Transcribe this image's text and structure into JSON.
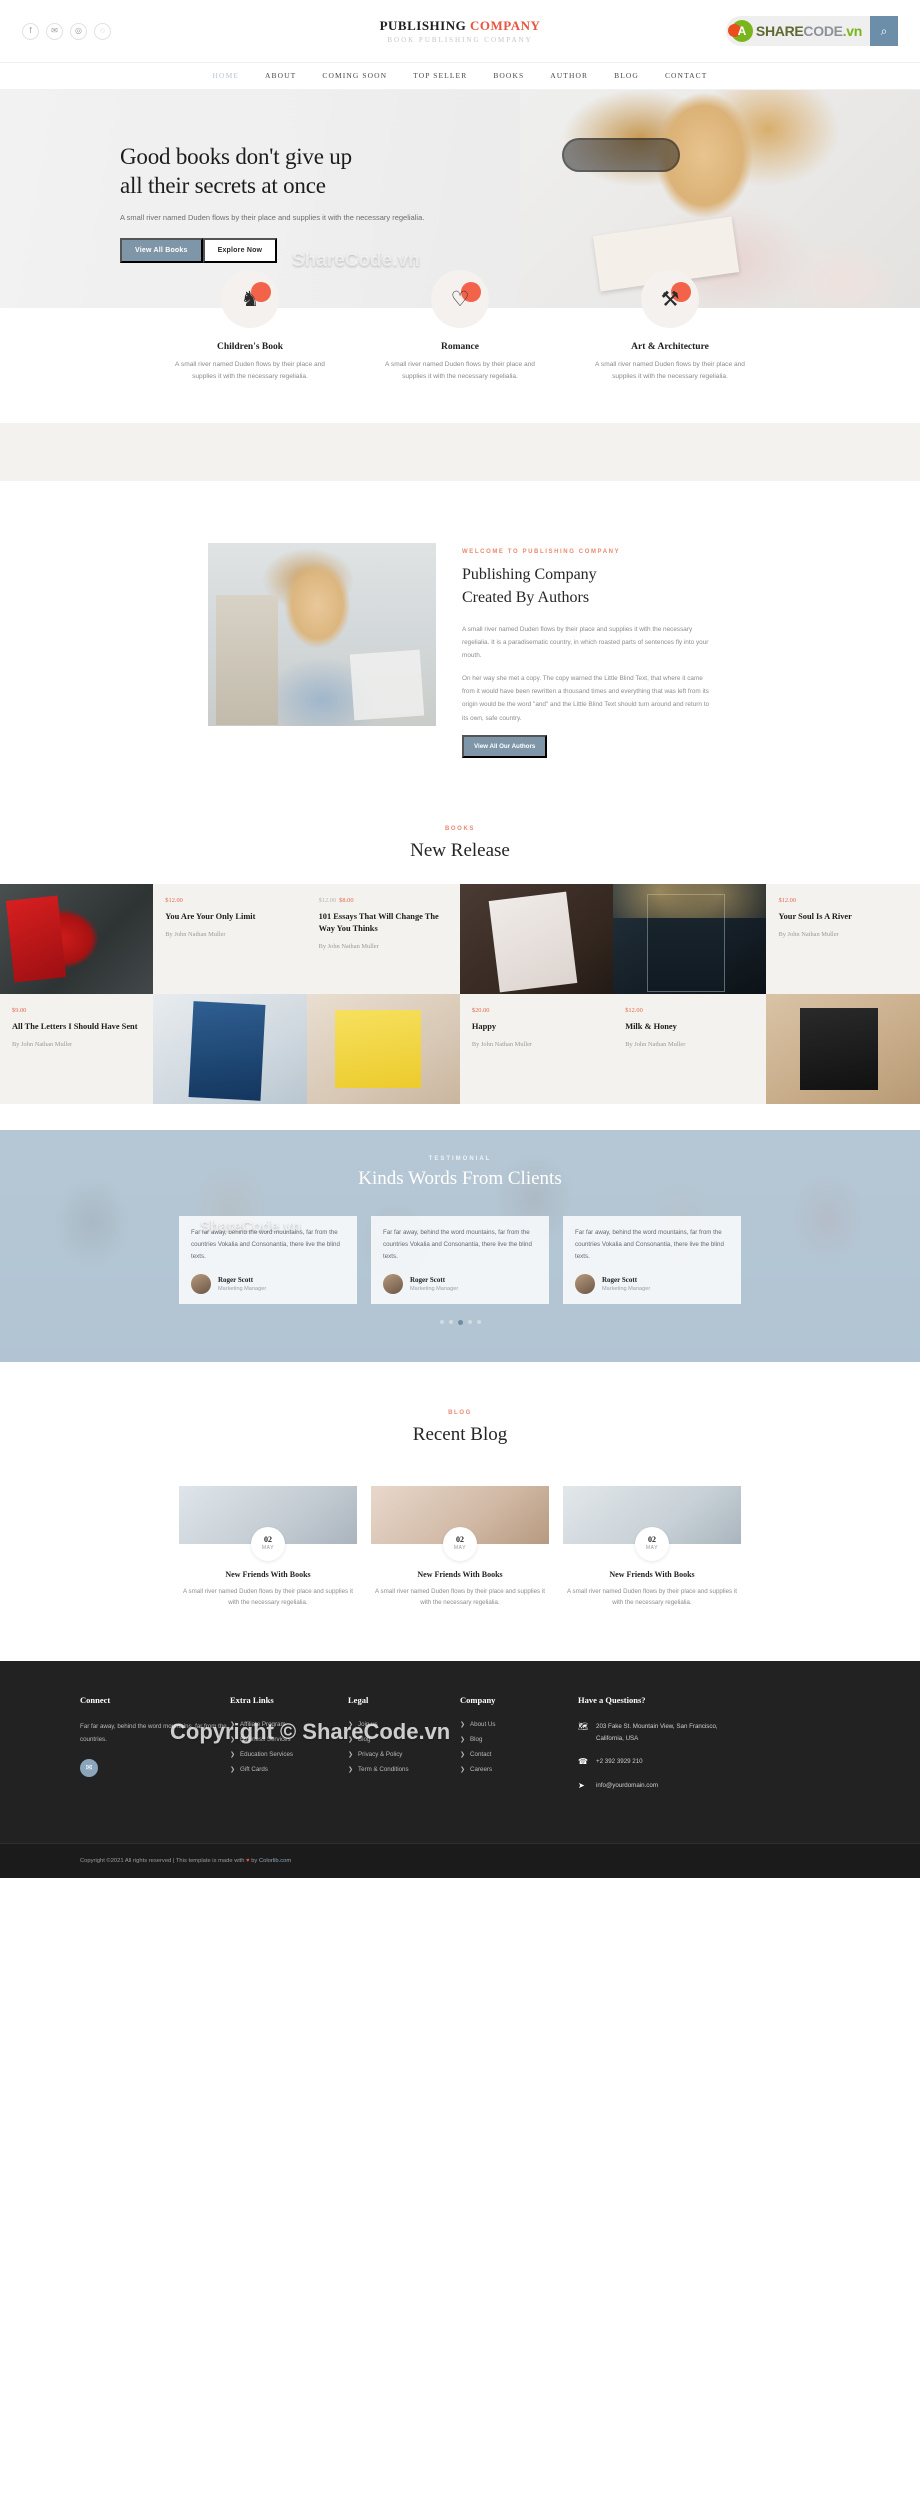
{
  "topbar": {
    "social": [
      {
        "name": "facebook-icon",
        "glyph": "f"
      },
      {
        "name": "twitter-icon",
        "glyph": "✉"
      },
      {
        "name": "instagram-icon",
        "glyph": "◎"
      },
      {
        "name": "dribbble-icon",
        "glyph": "◌"
      }
    ],
    "brand_main_1": "PUBLISHING ",
    "brand_main_2": "COMPANY",
    "brand_sub": "BOOK PUBLISHING COMPANY",
    "badge": {
      "leaf": "A",
      "share": "SHARE",
      "code": "CODE",
      "vn": ".vn",
      "search_icon": "⌕"
    }
  },
  "nav": {
    "items": [
      {
        "label": "HOME",
        "active": true
      },
      {
        "label": "ABOUT",
        "active": false
      },
      {
        "label": "COMING SOON",
        "active": false
      },
      {
        "label": "TOP SELLER",
        "active": false
      },
      {
        "label": "BOOKS",
        "active": false
      },
      {
        "label": "AUTHOR",
        "active": false
      },
      {
        "label": "BLOG",
        "active": false
      },
      {
        "label": "CONTACT",
        "active": false
      }
    ]
  },
  "hero": {
    "title_line1": "Good books don't give up",
    "title_line2": "all their secrets at once",
    "subtitle": "A small river named Duden flows by their place and supplies it with the necessary regelialia.",
    "btn_primary": "View All Books",
    "btn_ghost": "Explore Now"
  },
  "categories": [
    {
      "icon": "unicorn-icon",
      "glyph": "♞",
      "title": "Children's Book",
      "text": "A small river named Duden flows by their place and supplies it with the necessary regelialia."
    },
    {
      "icon": "heart-glasses-icon",
      "glyph": "♡",
      "title": "Romance",
      "text": "A small river named Duden flows by their place and supplies it with the necessary regelialia."
    },
    {
      "icon": "art-architecture-icon",
      "glyph": "⚒",
      "title": "Art & Architecture",
      "text": "A small river named Duden flows by their place and supplies it with the necessary regelialia."
    }
  ],
  "about": {
    "eyebrow": "WELCOME TO PUBLISHING COMPANY",
    "title_line1": "Publishing Company",
    "title_line2": "Created By Authors",
    "para1": "A small river named Duden flows by their place and supplies it with the necessary regelialia. It is a paradisematic country, in which roasted parts of sentences fly into your mouth.",
    "para2": "On her way she met a copy. The copy warned the Little Blind Text, that where it came from it would have been rewritten a thousand times and everything that was left from its origin would be the word \"and\" and the Little Blind Text should turn around and return to its own, safe country.",
    "button": "View All Our Authors"
  },
  "new_release": {
    "eyebrow": "BOOKS",
    "title": "New Release",
    "books": [
      {
        "price": "$12.00",
        "old_price": "",
        "title": "You Are Your Only Limit",
        "author": "By John Nathan Muller",
        "cover": "cov1",
        "reverse": false
      },
      {
        "price": "$8.00",
        "old_price": "$12.00",
        "title": "101 Essays That Will Change The Way You Thinks",
        "author": "By John Nathan Muller",
        "cover": "cov2",
        "reverse": true
      },
      {
        "price": "$12.00",
        "old_price": "",
        "title": "Your Soul Is A River",
        "author": "By John Nathan Muller",
        "cover": "cov3",
        "reverse": false
      },
      {
        "price": "$9.00",
        "old_price": "",
        "title": "All The Letters I Should Have Sent",
        "author": "By John Nathan Muller",
        "cover": "cov4",
        "reverse": true
      },
      {
        "price": "$20.00",
        "old_price": "",
        "title": "Happy",
        "author": "By John Nathan Muller",
        "cover": "cov5",
        "reverse": false
      },
      {
        "price": "$12.00",
        "old_price": "",
        "title": "Milk & Honey",
        "author": "By John Nathan Muller",
        "cover": "cov6",
        "reverse": true
      }
    ]
  },
  "testimonial": {
    "eyebrow": "TESTIMONIAL",
    "title": "Kinds Words From Clients",
    "quotes": [
      {
        "text": "Far far away, behind the word mountains, far from the countries Vokalia and Consonantia, there live the blind texts.",
        "name": "Roger Scott",
        "role": "Marketing Manager"
      },
      {
        "text": "Far far away, behind the word mountains, far from the countries Vokalia and Consonantia, there live the blind texts.",
        "name": "Roger Scott",
        "role": "Marketing Manager"
      },
      {
        "text": "Far far away, behind the word mountains, far from the countries Vokalia and Consonantia, there live the blind texts.",
        "name": "Roger Scott",
        "role": "Marketing Manager"
      }
    ],
    "dots": [
      false,
      false,
      true,
      false,
      false
    ]
  },
  "blog": {
    "eyebrow": "BLOG",
    "title": "Recent Blog",
    "posts": [
      {
        "day": "02",
        "month": "MAY",
        "title": "New Friends With Books",
        "text": "A small river named Duden flows by their place and supplies it with the necessary regelialia.",
        "img": "bi1"
      },
      {
        "day": "02",
        "month": "MAY",
        "title": "New Friends With Books",
        "text": "A small river named Duden flows by their place and supplies it with the necessary regelialia.",
        "img": "bi2"
      },
      {
        "day": "02",
        "month": "MAY",
        "title": "New Friends With Books",
        "text": "A small river named Duden flows by their place and supplies it with the necessary regelialia.",
        "img": "bi3"
      }
    ]
  },
  "footer": {
    "connect": {
      "heading": "Connect",
      "text": "Far far away, behind the word mountains, far from the countries.",
      "social_glyph": "✉"
    },
    "extra_links": {
      "heading": "Extra Links",
      "items": [
        "Affiliate Program",
        "Business Services",
        "Education Services",
        "Gift Cards"
      ]
    },
    "legal": {
      "heading": "Legal",
      "items": [
        "Join us",
        "Blog",
        "Privacy & Policy",
        "Term & Conditions"
      ]
    },
    "company": {
      "heading": "Company",
      "items": [
        "About Us",
        "Blog",
        "Contact",
        "Careers"
      ]
    },
    "questions": {
      "heading": "Have a Questions?",
      "address": "203 Fake St. Mountain View, San Francisco, California, USA",
      "phone": "+2 392 3929 210",
      "email": "info@yourdomain.com"
    },
    "bar": {
      "pre": "Copyright ©2021 All rights reserved | This template is made with ",
      "heart": "♥",
      "mid": " by ",
      "link": "Colorlib.com"
    }
  },
  "watermarks": {
    "hero": "ShareCode.vn",
    "books": "ShareCode.vn",
    "footer": "Copyright © ShareCode.vn"
  },
  "colors": {
    "accent": "#e8553e",
    "blue": "#7e96a8",
    "dark": "#222222",
    "cream": "#f4f2ee"
  }
}
